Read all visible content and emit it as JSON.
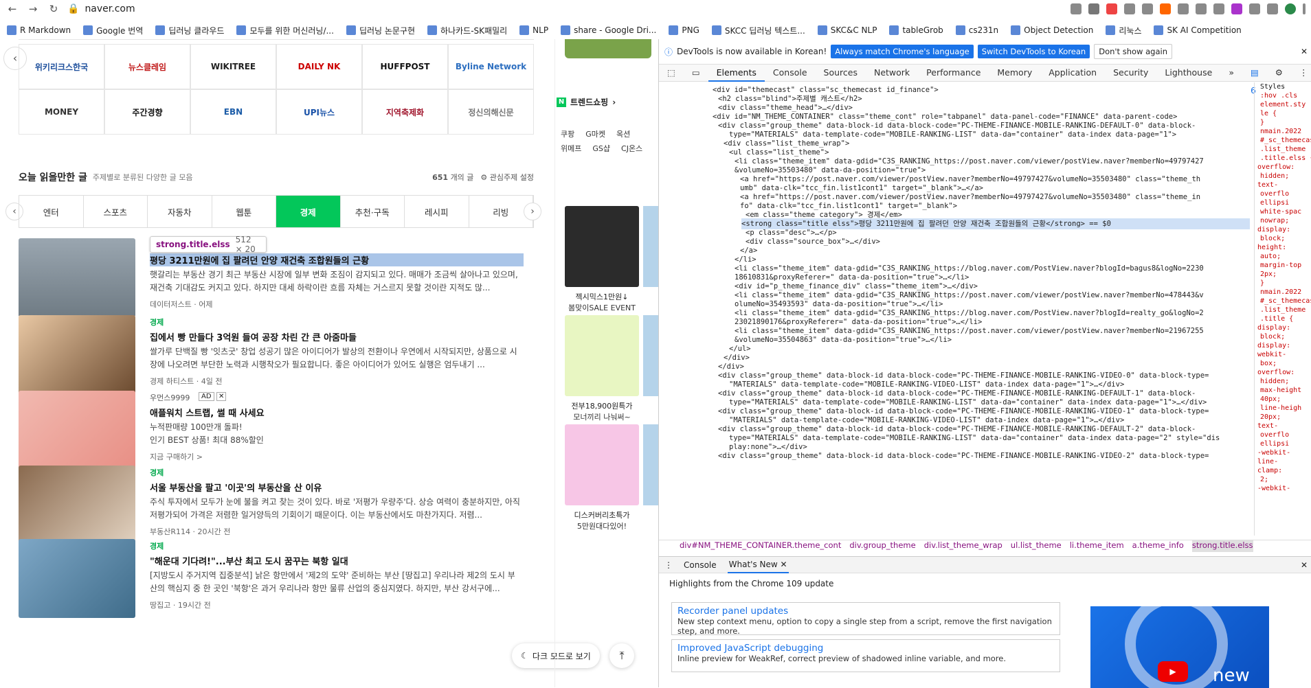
{
  "browser": {
    "url": "naver.com"
  },
  "bookmarks": [
    "R Markdown",
    "Google 번역",
    "딥러닝 클라우드",
    "모두를 위한 머신러닝/...",
    "딥러닝 논문구현",
    "하나카드-SK패밀리",
    "NLP",
    "share - Google Dri...",
    "PNG",
    "SKCC 딥러닝 텍스트...",
    "SKC&C NLP",
    "tableGrob",
    "cs231n",
    "Object Detection",
    "리눅스",
    "SK AI Competition"
  ],
  "logos": [
    "위키리크스한국",
    "뉴스클레임",
    "WIKITREE",
    "DAILY NK",
    "HUFFPOST",
    "Byline Network",
    "MONEY",
    "주간경향",
    "EBN",
    "UPI뉴스",
    "지역축제화",
    "정신의해신문"
  ],
  "section": {
    "title": "오늘 읽을만한 글",
    "subtitle": "주제별로 분류된 다양한 글 모음",
    "count": "651",
    "count_suffix": "개의 글",
    "settings": "관심주제 설정"
  },
  "tabs": [
    "엔터",
    "스포츠",
    "자동차",
    "웹툰",
    "경제",
    "추천·구독",
    "레시피",
    "리빙"
  ],
  "active_tab": "경제",
  "tooltip": {
    "name": "strong.title.elss",
    "size": "512 × 20"
  },
  "articles": [
    {
      "cat": "",
      "title": "평당 3211만원에 집 팔려던 안양 재건축 조합원들의 근황",
      "desc": "햇갈리는 부동산 경기 최근 부동산 시장에 일부 변화 조짐이 감지되고 있다. 매매가 조금씩 살아나고 있으며, 재건축 기대감도 커지고 있다. 하지만 대세 하락이란 흐름 자체는 거스르지 못할 것이란 지적도 많...",
      "src": "데이터저스트 · 어제"
    },
    {
      "cat": "경제",
      "title": "집에서 빵 만들다 3억원 들여 공장 차린 간 큰 아줌마들",
      "desc": "쌀가루 단백질 빵 '잇츠굿' 창업 성공기 많은 아이디어가 발상의 전환이나 우연에서 시작되지만, 상품으로 시장에 나오려면 부단한 노력과 시행착오가 필요합니다. 좋은 아이디어가 있어도 실행은 엄두내기 ...",
      "src": "경제 하티스트 · 4일 전"
    },
    {
      "cat": "우먼스9999",
      "ad": "AD",
      "title": "애플워치 스트랩, 썰 때 사세요",
      "desc": "누적판매량 100만개 돌파!\n인기 BEST 상품! 최대 88%할인",
      "src": "지금 구매하기 >"
    },
    {
      "cat": "경제",
      "title": "서울 부동산을 팔고 '이곳'의 부동산을 산 이유",
      "desc": "주식 투자에서 모두가 눈에 불을 켜고 찾는 것이 있다. 바로 '저평가 우량주'다. 상승 여력이 충분하지만, 아직 저평가되어 가격은 저렴한 일거양득의 기회이기 때문이다. 이는 부동산에서도 마찬가지다. 저렴...",
      "src": "부동산R114 · 20시간 전"
    },
    {
      "cat": "경제",
      "title": "\"해운대 기다려!\"...부산 최고 도시 꿈꾸는 북항 일대",
      "desc": "[지방도시 주거지역 집중분석] 낡은 항만에서 '제2의 도약' 준비하는 부산 [땅집고] 우리나라 제2의 도시 부산의 핵심지 중 한 곳인 '북항'은 과거 우리나라 항만 물류 산업의 중심지였다. 하지만, 부산 강서구에...",
      "src": "땅집고 · 19시간 전"
    }
  ],
  "float": {
    "dark": "다크 모드로 보기"
  },
  "shop": {
    "trend": "트렌드쇼핑",
    "malls1": [
      "쿠팡",
      "G마켓",
      "옥션"
    ],
    "malls2": [
      "위메프",
      "GS샵",
      "CJ온스"
    ],
    "products": [
      {
        "p1": "젝시믹스1만원↓",
        "p2": "봄맞이SALE EVENT"
      },
      {
        "p1": "전부18,900원특가",
        "p2": "모너끼리 나눠써~"
      },
      {
        "p1": "디스커버리초특가",
        "p2": "5만원대다있어!"
      }
    ]
  },
  "devtools": {
    "info": "DevTools is now available in Korean!",
    "btn1": "Always match Chrome's language",
    "btn2": "Switch DevTools to Korean",
    "btn3": "Don't show again",
    "tabs": [
      "Elements",
      "Console",
      "Sources",
      "Network",
      "Performance",
      "Memory",
      "Application",
      "Security",
      "Lighthouse"
    ],
    "badge": "6",
    "lines": [
      "<div id=\"themecast\" class=\"sc_themecast id_finance\">",
      "<h2 class=\"blind\">주제별 캐스트</h2>",
      "<div class=\"theme_head\">…</div>",
      "<div id=\"NM_THEME_CONTAINER\" class=\"theme_cont\" role=\"tabpanel\" data-panel-code=\"FINANCE\" data-parent-code>",
      "<div class=\"group_theme\" data-block-id data-block-code=\"PC-THEME-FINANCE-MOBILE-RANKING-DEFAULT-0\" data-block-",
      "type=\"MATERIALS\" data-template-code=\"MOBILE-RANKING-LIST\" data-da=\"container\" data-index data-page=\"1\">",
      "<div class=\"list_theme_wrap\">",
      "<ul class=\"list_theme\">",
      "<li class=\"theme_item\" data-gdid=\"C3S_RANKING_https://post.naver.com/viewer/postView.naver?memberNo=49797427",
      "&volumeNo=35503480\" data-da-position=\"true\">",
      "<a href=\"https://post.naver.com/viewer/postView.naver?memberNo=49797427&volumeNo=35503480\" class=\"theme_th",
      "umb\" data-clk=\"tcc_fin.list1cont1\" target=\"_blank\">…</a>",
      "<a href=\"https://post.naver.com/viewer/postView.naver?memberNo=49797427&volumeNo=35503480\" class=\"theme_in",
      "fo\" data-clk=\"tcc_fin.list1cont1\" target=\"_blank\">",
      "<em class=\"theme_category\"> 경제</em>",
      "<strong class=\"title elss\">평당 3211만원에 집 팔려던 안양 재건축 조합원들의 근황</strong> == $0",
      "<p class=\"desc\">…</p>",
      "<div class=\"source_box\">…</div>",
      "</a>",
      "</li>",
      "<li class=\"theme_item\" data-gdid=\"C3S_RANKING_https://blog.naver.com/PostView.naver?blogId=bagus8&logNo=2230",
      "18610831&proxyReferer=\" data-da-position=\"true\">…</li>",
      "<div id=\"p_theme_finance_div\" class=\"theme_item\">…</div>",
      "<li class=\"theme_item\" data-gdid=\"C3S_RANKING_https://post.naver.com/viewer/postView.naver?memberNo=478443&v",
      "olumeNo=35493593\" data-da-position=\"true\">…</li>",
      "<li class=\"theme_item\" data-gdid=\"C3S_RANKING_https://blog.naver.com/PostView.naver?blogId=realty_go&logNo=2",
      "23021890176&proxyReferer=\" data-da-position=\"true\">…</li>",
      "<li class=\"theme_item\" data-gdid=\"C3S_RANKING_https://post.naver.com/viewer/postView.naver?memberNo=21967255",
      "&volumeNo=35504863\" data-da-position=\"true\">…</li>",
      "</ul>",
      "</div>",
      "</div>",
      "<div class=\"group_theme\" data-block-id data-block-code=\"PC-THEME-FINANCE-MOBILE-RANKING-VIDEO-0\" data-block-type=",
      "\"MATERIALS\" data-template-code=\"MOBILE-RANKING-VIDEO-LIST\" data-index data-page=\"1\">…</div>",
      "<div class=\"group_theme\" data-block-id data-block-code=\"PC-THEME-FINANCE-MOBILE-RANKING-DEFAULT-1\" data-block-",
      "type=\"MATERIALS\" data-template-code=\"MOBILE-RANKING-LIST\" data-da=\"container\" data-index data-page=\"1\">…</div>",
      "<div class=\"group_theme\" data-block-id data-block-code=\"PC-THEME-FINANCE-MOBILE-RANKING-VIDEO-1\" data-block-type=",
      "\"MATERIALS\" data-template-code=\"MOBILE-RANKING-VIDEO-LIST\" data-index data-page=\"1\">…</div>",
      "<div class=\"group_theme\" data-block-id data-block-code=\"PC-THEME-FINANCE-MOBILE-RANKING-DEFAULT-2\" data-block-",
      "type=\"MATERIALS\" data-template-code=\"MOBILE-RANKING-LIST\" data-da=\"container\" data-index data-page=\"2\" style=\"dis",
      "play:none\">…</div>",
      "<div class=\"group_theme\" data-block-id data-block-code=\"PC-THEME-FINANCE-MOBILE-RANKING-VIDEO-2\" data-block-type="
    ],
    "styles": [
      "Styles",
      ":hov .cls",
      "element.sty",
      "le {",
      "}",
      "nmain.2022",
      "#_sc_themecast",
      ".list_theme",
      ".title.elss {",
      "overflow:",
      "hidden;",
      "text-",
      "overflo",
      "ellipsi",
      "white-spac",
      "nowrap;",
      "display:",
      "block;",
      "height:",
      "auto;",
      "margin-top",
      "2px;",
      "}",
      "nmain.2022",
      "#_sc_themecast",
      ".list_theme",
      ".title {",
      "display:",
      "block;",
      "display:",
      "webkit-",
      "box;",
      "overflow:",
      "hidden;",
      "max-height",
      "40px;",
      "line-heigh",
      "20px;",
      "text-",
      "overflo",
      "ellipsi",
      "-webkit-",
      "line-",
      "clamp:",
      "2;",
      "-webkit-"
    ],
    "crumbs": [
      "div#NM_THEME_CONTAINER.theme_cont",
      "div.group_theme",
      "div.list_theme_wrap",
      "ul.list_theme",
      "li.theme_item",
      "a.theme_info",
      "strong.title.elss"
    ],
    "drawer_tabs": [
      "Console",
      "What's New"
    ],
    "highlights": "Highlights from the Chrome 109 update",
    "cards": [
      {
        "h": "Recorder panel updates",
        "d": "New step context menu, option to copy a single step from a script, remove the first navigation step, and more."
      },
      {
        "h": "Improved JavaScript debugging",
        "d": "Inline preview for WeakRef, correct preview of shadowed inline variable, and more."
      }
    ],
    "promo": "new"
  }
}
